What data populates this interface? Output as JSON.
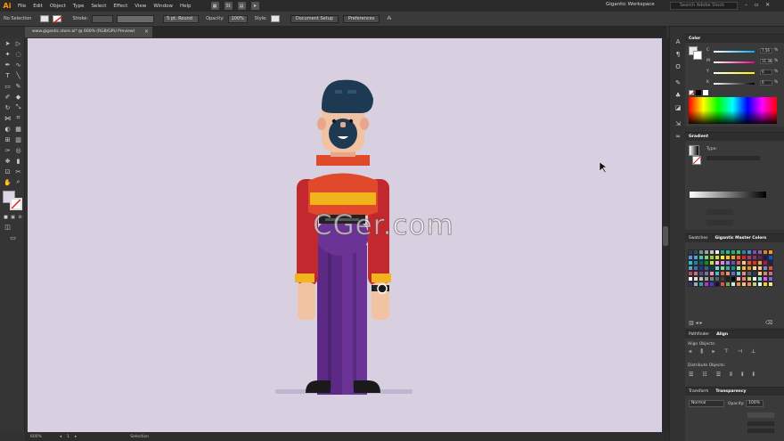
{
  "app": {
    "logo": "Ai",
    "menu": [
      "File",
      "Edit",
      "Object",
      "Type",
      "Select",
      "Effect",
      "View",
      "Window",
      "Help"
    ],
    "workspace": "Gigantic Workspace",
    "search_placeholder": "Search Adobe Stock",
    "window_buttons": [
      "–",
      "▫",
      "✕"
    ]
  },
  "control_bar": {
    "selection_label": "No Selection",
    "stroke_label": "Stroke:",
    "brush": "5 pt. Round",
    "opacity_label": "Opacity:",
    "opacity_value": "100%",
    "style_label": "Style:",
    "document_setup": "Document Setup",
    "preferences": "Preferences"
  },
  "document_tab": {
    "title": "www.gigantic.store.ai* @ 600% (RGB/GPU Preview)",
    "close": "✕"
  },
  "status_bar": {
    "zoom": "600%",
    "artboard": "1",
    "mode": "Selection"
  },
  "watermark": "CGer.com",
  "panels": {
    "color": {
      "title": "Color",
      "channels": [
        {
          "letter": "C",
          "value": "7.56",
          "unit": "%",
          "color": "#00aeef"
        },
        {
          "letter": "M",
          "value": "11.36",
          "unit": "%",
          "color": "#ec008c"
        },
        {
          "letter": "Y",
          "value": "0",
          "unit": "%",
          "color": "#fff200"
        },
        {
          "letter": "K",
          "value": "0",
          "unit": "%",
          "color": "#888888"
        }
      ]
    },
    "gradient": {
      "title": "Gradient",
      "type_label": "Type:"
    },
    "swatches": {
      "tabs": [
        "Swatches",
        "Gigantic Master Colors"
      ],
      "colors": [
        "#2c3e50",
        "#34495e",
        "#7f8c8d",
        "#95a5a6",
        "#bdc3c7",
        "#ecf0f1",
        "#16a085",
        "#1abc9c",
        "#27ae60",
        "#2ecc71",
        "#2980b9",
        "#3498db",
        "#8e44ad",
        "#9b59b6",
        "#e67e22",
        "#f39c12",
        "#5b8def",
        "#4aa3df",
        "#43c6ac",
        "#7bd389",
        "#a3cb38",
        "#c4e538",
        "#fff200",
        "#ffc312",
        "#f79f1f",
        "#ee5a24",
        "#ea2027",
        "#b53471",
        "#833471",
        "#6f1e51",
        "#1b1464",
        "#0652dd",
        "#12cbc4",
        "#1289a7",
        "#006266",
        "#009432",
        "#c4e538",
        "#fda7df",
        "#d980fa",
        "#9980fa",
        "#5758bb",
        "#ed4c67",
        "#f8c291",
        "#e55039",
        "#eb2f06",
        "#fa983a",
        "#b71540",
        "#0c2461",
        "#60a3bc",
        "#4a69bd",
        "#1e3799",
        "#3c6382",
        "#0a3d62",
        "#82ccdd",
        "#78e08f",
        "#38ada9",
        "#079992",
        "#b8e994",
        "#f6b93b",
        "#e58e26",
        "#fad390",
        "#f8c291",
        "#6a89cc",
        "#e55039",
        "#c44569",
        "#cf6a87",
        "#574b90",
        "#786fa6",
        "#f78fb3",
        "#3dc1d3",
        "#e15f41",
        "#f19066",
        "#546de5",
        "#63cdda",
        "#ea8685",
        "#596275",
        "#303952",
        "#f5cd79",
        "#e77f67",
        "#cf6a87",
        "#ffffff",
        "#e0e0e0",
        "#c0c0c0",
        "#a0a0a0",
        "#808080",
        "#606060",
        "#404040",
        "#202020",
        "#000000",
        "#ffb8b8",
        "#ff7979",
        "#badc58",
        "#dff9fb",
        "#7ed6df",
        "#e056fd",
        "#686de0",
        "#30336b",
        "#95afc0",
        "#22a6b3",
        "#be2edd",
        "#4834d4",
        "#130f40",
        "#eb4d4b",
        "#6ab04c",
        "#c7ecee",
        "#f0932b",
        "#ffbe76",
        "#ff7979",
        "#badc58",
        "#dff9fb",
        "#f9ca24",
        "#f6e58d"
      ]
    },
    "align": {
      "tabs": [
        "Pathfinder",
        "Align"
      ],
      "align_objects": "Align Objects:",
      "distribute_objects": "Distribute Objects:"
    },
    "transparency": {
      "tabs": [
        "Transform",
        "Transparency"
      ],
      "mode": "Normal",
      "opacity_label": "Opacity:",
      "opacity_value": "100%"
    }
  }
}
